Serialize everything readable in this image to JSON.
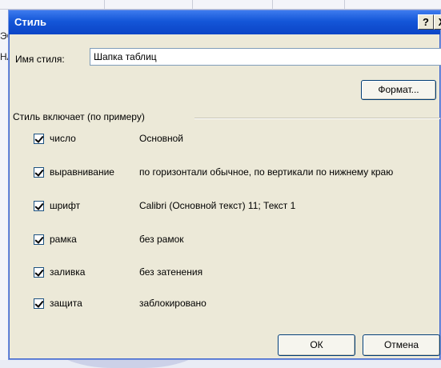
{
  "background": {
    "fragments": [
      "ЭС",
      "НА"
    ]
  },
  "dialog": {
    "title": "Стиль",
    "help_symbol": "?",
    "close_symbol": "X",
    "style_name_label": "Имя стиля:",
    "style_name_value": "Шапка таблиц",
    "format_button": "Формат...",
    "group_title": "Стиль включает (по примеру)",
    "options": [
      {
        "label": "число",
        "value": "Основной",
        "checked": true
      },
      {
        "label": "выравнивание",
        "value": "по горизонтали обычное, по вертикали по нижнему краю",
        "checked": true
      },
      {
        "label": "шрифт",
        "value": "Calibri (Основной текст) 11; Текст 1",
        "checked": true
      },
      {
        "label": "рамка",
        "value": "без рамок",
        "checked": true
      },
      {
        "label": "заливка",
        "value": "без затенения",
        "checked": true
      },
      {
        "label": "защита",
        "value": "заблокировано",
        "checked": true
      }
    ],
    "ok_button": "ОК",
    "cancel_button": "Отмена"
  },
  "colors": {
    "title_bar": "#1456d8",
    "dialog_bg": "#ece9d8"
  }
}
